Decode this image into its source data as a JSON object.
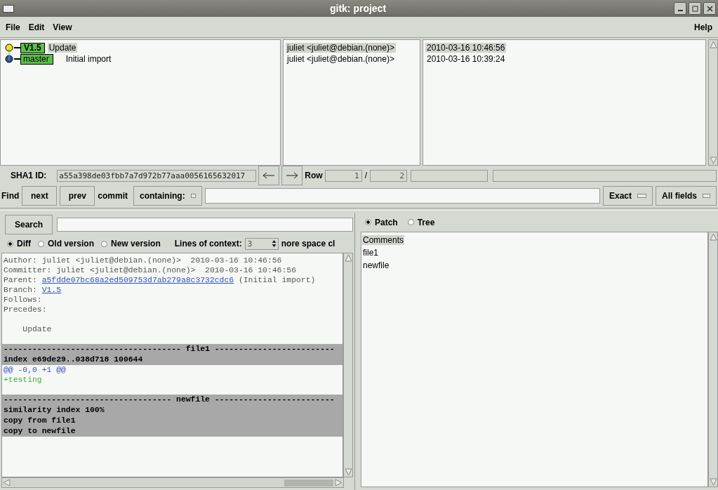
{
  "window": {
    "title": "gitk: project"
  },
  "menu": [
    {
      "label": "File"
    },
    {
      "label": "Edit"
    },
    {
      "label": "View"
    }
  ],
  "help_menu": {
    "label": "Help"
  },
  "commits": [
    {
      "refs": [
        "V1.5"
      ],
      "subject": "Update",
      "author": "juliet <juliet@debian.(none)>",
      "date": "2010-03-16 10:46:56",
      "selected": true,
      "color": "#f0e020"
    },
    {
      "refs": [
        "master"
      ],
      "subject": "Initial import",
      "author": "juliet <juliet@debian.(none)>",
      "date": "2010-03-16 10:39:24",
      "selected": false,
      "color": "#3050a0"
    }
  ],
  "sha1": {
    "label": "SHA1 ID:",
    "value": "a55a398de03fbb7a7d972b77aaa0056165632017"
  },
  "row": {
    "label": "Row",
    "current": "1",
    "separator": "/",
    "total": "2"
  },
  "find": {
    "label": "Find",
    "next": "next",
    "prev": "prev",
    "type": "commit",
    "mode": "containing:",
    "match": "Exact",
    "fields": "All fields"
  },
  "search": {
    "button": "Search"
  },
  "diff_options": [
    {
      "label": "Diff",
      "selected": true
    },
    {
      "label": "Old version",
      "selected": false
    },
    {
      "label": "New version",
      "selected": false
    }
  ],
  "context": {
    "label": "Lines of context:",
    "value": "3"
  },
  "ignore_space": {
    "label": "nore space cl"
  },
  "diff_lines": [
    {
      "kind": "text",
      "text": "Author: juliet <juliet@debian.(none)>  2010-03-16 10:46:56"
    },
    {
      "kind": "text",
      "text": "Committer: juliet <juliet@debian.(none)>  2010-03-16 10:46:56"
    },
    {
      "kind": "link",
      "text": "Parent: ",
      "link": "a5fdde07bc68a2ed509753d7ab279a8c3732cdc6",
      "rest": " (Initial import)"
    },
    {
      "kind": "link",
      "text": "Branch: ",
      "link": "V1.5"
    },
    {
      "kind": "text",
      "text": "Follows:"
    },
    {
      "kind": "text",
      "text": "Precedes:"
    },
    {
      "kind": "blank"
    },
    {
      "kind": "text",
      "text": "    Update"
    },
    {
      "kind": "blank"
    },
    {
      "kind": "filehead",
      "text": "------------------------------------- file1 -------------------------"
    },
    {
      "kind": "meta",
      "text": "index e69de29..038d718 100644"
    },
    {
      "kind": "hunk",
      "text": "@@ -0,0 +1 @@"
    },
    {
      "kind": "add",
      "text": "+testing"
    },
    {
      "kind": "blank"
    },
    {
      "kind": "filehead",
      "text": "----------------------------------- newfile -------------------------"
    },
    {
      "kind": "meta",
      "text": "similarity index 100%"
    },
    {
      "kind": "meta",
      "text": "copy from file1"
    },
    {
      "kind": "meta",
      "text": "copy to newfile"
    }
  ],
  "file_view": [
    {
      "label": "Patch",
      "selected": true
    },
    {
      "label": "Tree",
      "selected": false
    }
  ],
  "files": [
    {
      "label": "Comments",
      "selected": true
    },
    {
      "label": "file1",
      "selected": false
    },
    {
      "label": "newfile",
      "selected": false
    }
  ]
}
